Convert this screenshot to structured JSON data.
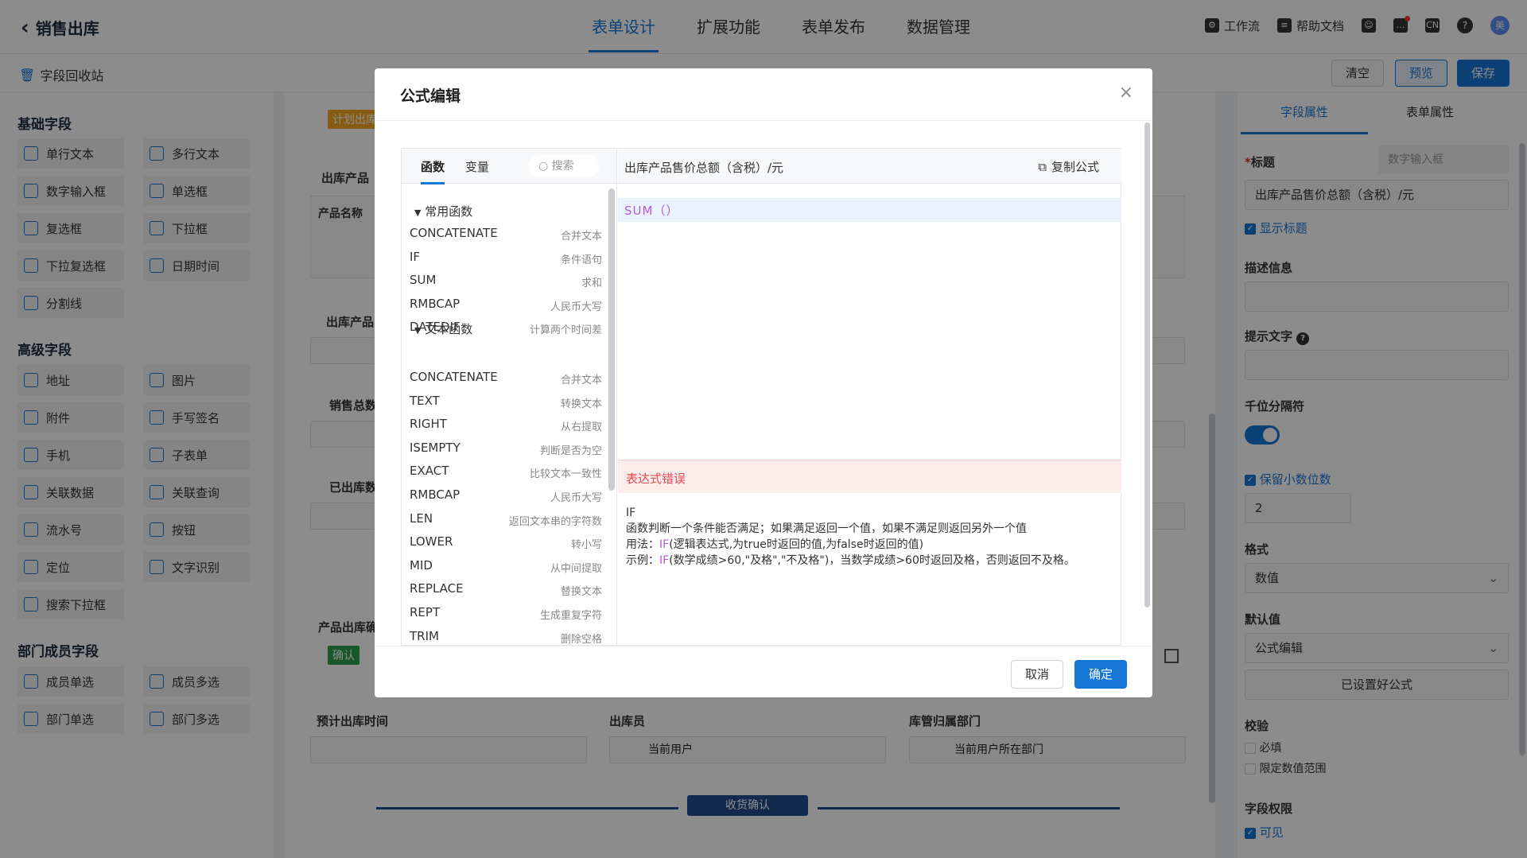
{
  "header": {
    "back_title": "销售出库",
    "tabs": [
      "表单设计",
      "扩展功能",
      "表单发布",
      "数据管理"
    ],
    "tools": {
      "workflow": "工作流",
      "help_docs": "帮助文档",
      "avatar": "美"
    }
  },
  "subbar": {
    "recycle": "字段回收站",
    "clear": "清空",
    "preview": "预览",
    "save": "保存"
  },
  "left": {
    "basic_title": "基础字段",
    "basic": [
      "单行文本",
      "多行文本",
      "数字输入框",
      "单选框",
      "复选框",
      "下拉框",
      "下拉复选框",
      "日期时间",
      "分割线"
    ],
    "advanced_title": "高级字段",
    "advanced": [
      "地址",
      "图片",
      "附件",
      "手写签名",
      "手机",
      "子表单",
      "关联数据",
      "关联查询",
      "流水号",
      "按钮",
      "定位",
      "文字识别",
      "搜索下拉框"
    ],
    "dept_title": "部门成员字段",
    "dept": [
      "成员单选",
      "成员多选",
      "部门单选",
      "部门多选"
    ]
  },
  "canvas": {
    "badge_plan": "计划出库",
    "product_label": "出库产品",
    "product_name_col": "产品名称",
    "product_label2": "出库产品",
    "sales_total": "销售总数",
    "shipped": "已出库数",
    "product_confirm": "产品出库确",
    "confirm_badge": "确认",
    "expected_time": "预计出库时间",
    "clerk": "出库员",
    "dept": "库管归属部门",
    "current_user": "当前用户",
    "current_dept": "当前用户所在部门",
    "divider": "收货确认"
  },
  "right": {
    "tab_field": "字段属性",
    "tab_form": "表单属性",
    "title_label": "标题",
    "title_type": "数字输入框",
    "title_value": "出库产品售价总额（含税）/元",
    "show_title": "显示标题",
    "desc_label": "描述信息",
    "hint_label": "提示文字",
    "thousand_label": "千位分隔符",
    "keep_decimal": "保留小数位数",
    "decimal_value": "2",
    "format_label": "格式",
    "format_value": "数值",
    "default_label": "默认值",
    "default_value": "公式编辑",
    "formula_set": "已设置好公式",
    "validate_label": "校验",
    "required": "必填",
    "limit_range": "限定数值范围",
    "perm_label": "字段权限",
    "visible": "可见"
  },
  "modal": {
    "title": "公式编辑",
    "tab_func": "函数",
    "tab_var": "变量",
    "search_placeholder": "搜索",
    "group_common": "常用函数",
    "common": [
      {
        "name": "CONCATENATE",
        "desc": "合并文本"
      },
      {
        "name": "IF",
        "desc": "条件语句"
      },
      {
        "name": "SUM",
        "desc": "求和"
      },
      {
        "name": "RMBCAP",
        "desc": "人民币大写"
      },
      {
        "name": "DATEDIF",
        "desc": "计算两个时间差"
      }
    ],
    "group_text": "文本函数",
    "text": [
      {
        "name": "CONCATENATE",
        "desc": "合并文本"
      },
      {
        "name": "TEXT",
        "desc": "转换文本"
      },
      {
        "name": "RIGHT",
        "desc": "从右提取"
      },
      {
        "name": "ISEMPTY",
        "desc": "判断是否为空"
      },
      {
        "name": "EXACT",
        "desc": "比较文本一致性"
      },
      {
        "name": "RMBCAP",
        "desc": "人民币大写"
      },
      {
        "name": "LEN",
        "desc": "返回文本串的字符数"
      },
      {
        "name": "LOWER",
        "desc": "转小写"
      },
      {
        "name": "MID",
        "desc": "从中间提取"
      },
      {
        "name": "REPLACE",
        "desc": "替换文本"
      },
      {
        "name": "REPT",
        "desc": "生成重复字符"
      },
      {
        "name": "TRIM",
        "desc": "删除空格"
      }
    ],
    "target_field": "出库产品售价总额（含税）/元",
    "copy_formula": "复制公式",
    "formula": "SUM（）",
    "error": "表达式错误",
    "help_name": "IF",
    "help_desc": "函数判断一个条件能否满足；如果满足返回一个值，如果不满足则返回另外一个值",
    "help_usage_prefix": "用法：",
    "help_usage_kw": "IF",
    "help_usage_rest": "(逻辑表达式,为true时返回的值,为false时返回的值)",
    "help_example_prefix": "示例：",
    "help_example_kw": "IF",
    "help_example_rest": "(数学成绩>60,\"及格\",\"不及格\")，当数学成绩>60时返回及格，否则返回不及格。",
    "cancel": "取消",
    "ok": "确定"
  }
}
